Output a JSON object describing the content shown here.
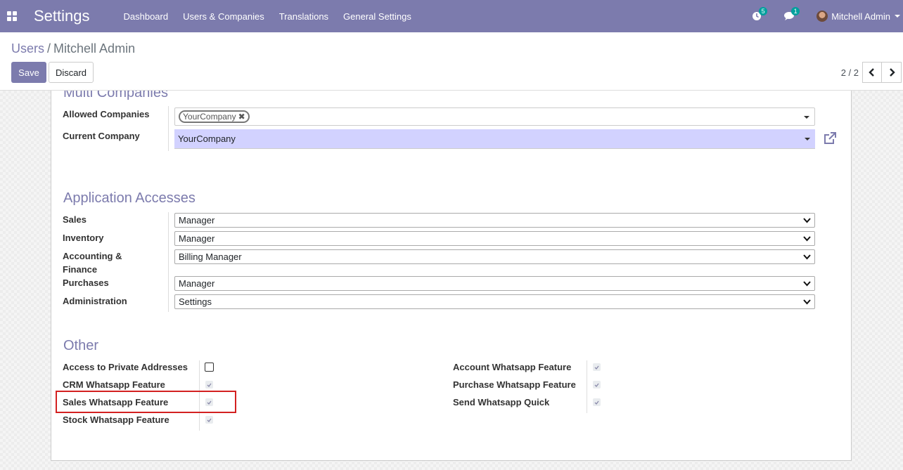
{
  "navbar": {
    "app_title": "Settings",
    "menu": [
      "Dashboard",
      "Users & Companies",
      "Translations",
      "General Settings"
    ],
    "activity_count": "5",
    "message_count": "1",
    "user_name": "Mitchell Admin"
  },
  "breadcrumb": {
    "parent": "Users",
    "separator": "/",
    "current": "Mitchell Admin"
  },
  "buttons": {
    "save": "Save",
    "discard": "Discard"
  },
  "pager": {
    "value": "2 / 2"
  },
  "multi_companies": {
    "title": "Multi Companies",
    "allowed_label": "Allowed Companies",
    "allowed_tags": [
      "YourCompany"
    ],
    "current_label": "Current Company",
    "current_value": "YourCompany"
  },
  "app_access": {
    "title": "Application Accesses",
    "rows": [
      {
        "label": "Sales",
        "value": "Manager"
      },
      {
        "label": "Inventory",
        "value": "Manager"
      },
      {
        "label": "Accounting & Finance",
        "value": "Billing Manager"
      },
      {
        "label": "Purchases",
        "value": "Manager"
      },
      {
        "label": "Administration",
        "value": "Settings"
      }
    ]
  },
  "other": {
    "title": "Other",
    "left": [
      {
        "label": "Access to Private Addresses",
        "checked": false
      },
      {
        "label": "CRM Whatsapp Feature",
        "checked": true
      },
      {
        "label": "Sales Whatsapp Feature",
        "checked": true
      },
      {
        "label": "Stock Whatsapp Feature",
        "checked": true
      }
    ],
    "right": [
      {
        "label": "Account Whatsapp Feature",
        "checked": true
      },
      {
        "label": "Purchase Whatsapp Feature",
        "checked": true
      },
      {
        "label": "Send Whatsapp Quick",
        "checked": true
      }
    ]
  },
  "colors": {
    "brand": "#7c7bad",
    "badge": "#00a09d",
    "highlight": "#d32020",
    "current_company_bg": "#d2d2ff"
  }
}
